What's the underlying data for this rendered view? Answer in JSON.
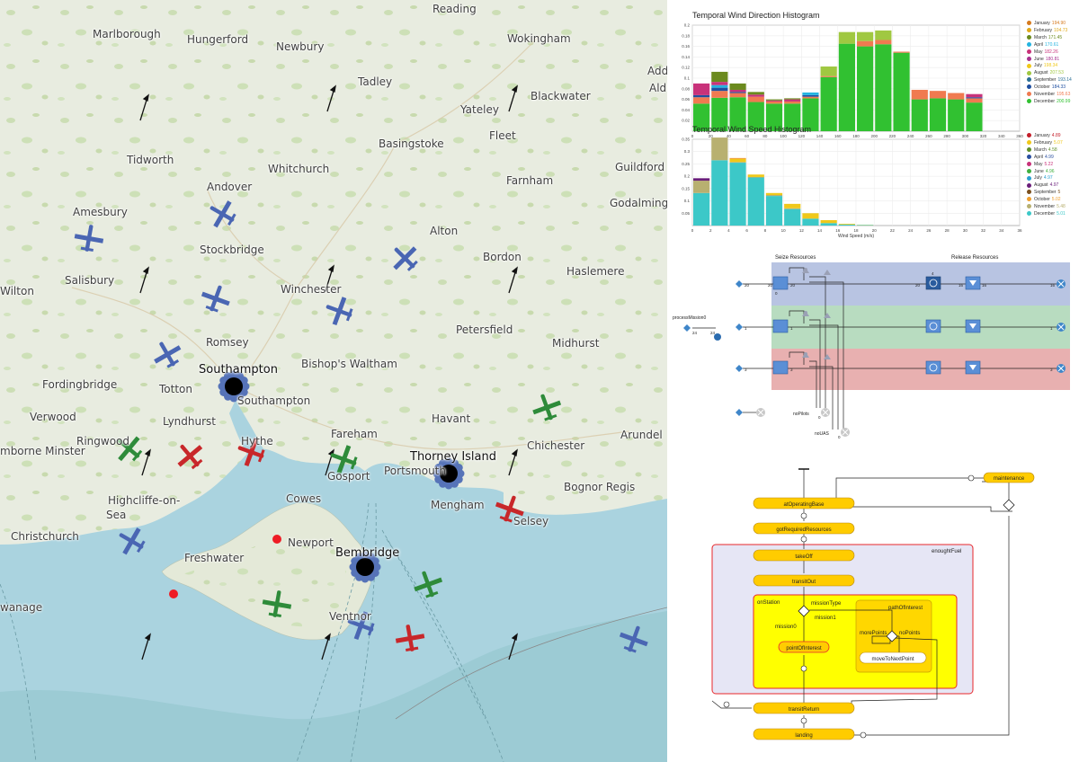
{
  "map": {
    "place_labels": [
      {
        "name": "Reading",
        "x": 481,
        "y": 10
      },
      {
        "name": "Marlborough",
        "x": 103,
        "y": 38
      },
      {
        "name": "Hungerford",
        "x": 208,
        "y": 44
      },
      {
        "name": "Newbury",
        "x": 307,
        "y": 52
      },
      {
        "name": "Wokingham",
        "x": 564,
        "y": 43
      },
      {
        "name": "Add",
        "x": 720,
        "y": 79
      },
      {
        "name": "Tadley",
        "x": 398,
        "y": 91
      },
      {
        "name": "Blackwater",
        "x": 590,
        "y": 107
      },
      {
        "name": "Yateley",
        "x": 512,
        "y": 122
      },
      {
        "name": "Ald",
        "x": 722,
        "y": 98
      },
      {
        "name": "Fleet",
        "x": 544,
        "y": 151
      },
      {
        "name": "Basingstoke",
        "x": 421,
        "y": 160
      },
      {
        "name": "Tidworth",
        "x": 141,
        "y": 178
      },
      {
        "name": "Whitchurch",
        "x": 298,
        "y": 188
      },
      {
        "name": "Farnham",
        "x": 563,
        "y": 201
      },
      {
        "name": "Guildford",
        "x": 684,
        "y": 186
      },
      {
        "name": "Andover",
        "x": 230,
        "y": 208
      },
      {
        "name": "Godalming",
        "x": 678,
        "y": 226
      },
      {
        "name": "Amesbury",
        "x": 81,
        "y": 236
      },
      {
        "name": "Stockbridge",
        "x": 222,
        "y": 278
      },
      {
        "name": "Alton",
        "x": 478,
        "y": 257
      },
      {
        "name": "Bordon",
        "x": 537,
        "y": 286
      },
      {
        "name": "Haslemere",
        "x": 630,
        "y": 302
      },
      {
        "name": "Salisbury",
        "x": 72,
        "y": 312
      },
      {
        "name": "Wilton",
        "x": 0,
        "y": 324
      },
      {
        "name": "Winchester",
        "x": 312,
        "y": 322
      },
      {
        "name": "Romsey",
        "x": 229,
        "y": 381
      },
      {
        "name": "Petersfield",
        "x": 507,
        "y": 367
      },
      {
        "name": "Midhurst",
        "x": 614,
        "y": 382
      },
      {
        "name": "Bishop's Waltham",
        "x": 335,
        "y": 405
      },
      {
        "name": "Fordingbridge",
        "x": 47,
        "y": 428
      },
      {
        "name": "Totton",
        "x": 177,
        "y": 433
      },
      {
        "name": "Southampton",
        "x": 264,
        "y": 446
      },
      {
        "name": "Havant",
        "x": 480,
        "y": 466
      },
      {
        "name": "Verwood",
        "x": 33,
        "y": 464
      },
      {
        "name": "Lyndhurst",
        "x": 181,
        "y": 469
      },
      {
        "name": "Ringwood",
        "x": 85,
        "y": 491
      },
      {
        "name": "Hythe",
        "x": 268,
        "y": 491
      },
      {
        "name": "Fareham",
        "x": 368,
        "y": 483
      },
      {
        "name": "Chichester",
        "x": 586,
        "y": 496
      },
      {
        "name": "Arundel",
        "x": 690,
        "y": 484
      },
      {
        "name": "Portsmouth",
        "x": 427,
        "y": 524
      },
      {
        "name": "Gosport",
        "x": 364,
        "y": 530
      },
      {
        "name": "mborne Minster",
        "x": 0,
        "y": 502
      },
      {
        "name": "Highcliffe-on-",
        "x": 120,
        "y": 557
      },
      {
        "name": "Sea",
        "x": 118,
        "y": 573
      },
      {
        "name": "Cowes",
        "x": 318,
        "y": 555
      },
      {
        "name": "Mengham",
        "x": 479,
        "y": 562
      },
      {
        "name": "Bognor Regis",
        "x": 627,
        "y": 542
      },
      {
        "name": "Selsey",
        "x": 571,
        "y": 580
      },
      {
        "name": "Christchurch",
        "x": 12,
        "y": 597
      },
      {
        "name": "Newport",
        "x": 320,
        "y": 604
      },
      {
        "name": "Freshwater",
        "x": 205,
        "y": 621
      },
      {
        "name": "wanage",
        "x": 0,
        "y": 676
      },
      {
        "name": "Ventnor",
        "x": 366,
        "y": 686
      }
    ],
    "bases": [
      {
        "name": "Southampton",
        "x": 221,
        "y": 412
      },
      {
        "name": "Thorney Island",
        "x": 456,
        "y": 509
      },
      {
        "name": "Bembridge",
        "x": 373,
        "y": 616
      }
    ],
    "colors": {
      "land": "#e8ece0",
      "sea": "#aad3df",
      "sea_deep": "#8fc3c9",
      "plane_blue": "#4a66b3",
      "plane_green": "#2e8b3a",
      "plane_red": "#c8272a",
      "base": "#000000",
      "incident": "#ee1c25"
    }
  },
  "direction_histogram": {
    "title": "Temporal Wind Direction Histogram",
    "xlabel": "Wind Direction (deg)",
    "legend": [
      {
        "month": "January",
        "value": "194.90",
        "color": "#d67a1e"
      },
      {
        "month": "February",
        "value": "104.73",
        "color": "#e0a81a"
      },
      {
        "month": "March",
        "value": "171.45",
        "color": "#6b8a1e"
      },
      {
        "month": "April",
        "value": "170.61",
        "color": "#24b4e0"
      },
      {
        "month": "May",
        "value": "182.26",
        "color": "#c8327a"
      },
      {
        "month": "June",
        "value": "180.81",
        "color": "#a8328f"
      },
      {
        "month": "July",
        "value": "198.34",
        "color": "#f0c81a"
      },
      {
        "month": "August",
        "value": "207.53",
        "color": "#a0c841"
      },
      {
        "month": "September",
        "value": "193.14",
        "color": "#2a6f96"
      },
      {
        "month": "October",
        "value": "184.33",
        "color": "#1f4fa0"
      },
      {
        "month": "November",
        "value": "195.63",
        "color": "#f07a50"
      },
      {
        "month": "December",
        "value": "200.99",
        "color": "#31c131"
      }
    ]
  },
  "speed_histogram": {
    "title": "Temporal Wind Speed Histogram",
    "xlabel": "Wind Speed (m/s)",
    "legend": [
      {
        "month": "January",
        "value": "4.89",
        "color": "#c41e2a"
      },
      {
        "month": "February",
        "value": "5.07",
        "color": "#f0c81a"
      },
      {
        "month": "March",
        "value": "4.58",
        "color": "#5f8f2a"
      },
      {
        "month": "April",
        "value": "4.99",
        "color": "#2a4fa0"
      },
      {
        "month": "May",
        "value": "5.22",
        "color": "#c8327a"
      },
      {
        "month": "June",
        "value": "4.96",
        "color": "#40b040"
      },
      {
        "month": "July",
        "value": "4.97",
        "color": "#2aa0d0"
      },
      {
        "month": "August",
        "value": "4.97",
        "color": "#6a1e7a"
      },
      {
        "month": "September",
        "value": "5",
        "color": "#7a4f1e"
      },
      {
        "month": "October",
        "value": "5.02",
        "color": "#f0a030"
      },
      {
        "month": "November",
        "value": "5.48",
        "color": "#b8b070"
      },
      {
        "month": "December",
        "value": "5.01",
        "color": "#3cc8c8"
      }
    ]
  },
  "chart_data": [
    {
      "type": "bar",
      "title": "Temporal Wind Direction Histogram",
      "xlabel": "Wind Direction (deg)",
      "ylabel": "",
      "xlim": [
        0,
        360
      ],
      "ylim": [
        0,
        0.2
      ],
      "x_ticks": [
        0,
        20,
        40,
        60,
        80,
        100,
        120,
        140,
        160,
        180,
        200,
        220,
        240,
        260,
        280,
        300,
        320,
        340,
        360
      ],
      "y_ticks": [
        0.02,
        0.04,
        0.06,
        0.08,
        0.1,
        0.12,
        0.14,
        0.16,
        0.18,
        0.2
      ],
      "categories": [
        10,
        30,
        50,
        70,
        90,
        110,
        130,
        150,
        170,
        190,
        210,
        230,
        250,
        270,
        290,
        310,
        330,
        350
      ],
      "series": [
        {
          "name": "December",
          "color": "#31c131",
          "values": [
            0.052,
            0.063,
            0.064,
            0.055,
            0.052,
            0.052,
            0.062,
            0.102,
            0.165,
            0.16,
            0.164,
            0.148,
            0.06,
            0.062,
            0.06,
            0.054,
            0,
            0
          ]
        },
        {
          "name": "November",
          "color": "#f07a50",
          "values": [
            0.012,
            0.013,
            0.008,
            0.01,
            0.004,
            0.004,
            0.003,
            0.002,
            0,
            0.01,
            0.008,
            0.002,
            0.018,
            0.014,
            0.012,
            0.008,
            0,
            0
          ]
        },
        {
          "name": "October",
          "color": "#1f4fa0",
          "values": [
            0.004,
            0.006,
            0.002,
            0,
            0,
            0,
            0.003,
            0,
            0,
            0,
            0,
            0,
            0,
            0,
            0,
            0.002,
            0,
            0
          ]
        },
        {
          "name": "April",
          "color": "#24b4e0",
          "values": [
            0,
            0.005,
            0,
            0,
            0,
            0,
            0.005,
            0,
            0,
            0,
            0,
            0,
            0,
            0,
            0,
            0,
            0,
            0
          ]
        },
        {
          "name": "May",
          "color": "#c8327a",
          "values": [
            0.022,
            0.006,
            0.004,
            0.004,
            0.002,
            0.004,
            0,
            0,
            0,
            0,
            0,
            0,
            0,
            0,
            0,
            0.006,
            0,
            0
          ]
        },
        {
          "name": "March",
          "color": "#6b8a1e",
          "values": [
            0,
            0.019,
            0.012,
            0.005,
            0.002,
            0.002,
            0,
            0,
            0,
            0,
            0,
            0,
            0,
            0,
            0,
            0,
            0,
            0
          ]
        },
        {
          "name": "August",
          "color": "#a0c841",
          "values": [
            0,
            0,
            0,
            0,
            0,
            0,
            0,
            0.018,
            0.022,
            0.017,
            0.018,
            0,
            0,
            0,
            0,
            0,
            0,
            0
          ]
        }
      ]
    },
    {
      "type": "bar",
      "title": "Temporal Wind Speed Histogram",
      "xlabel": "Wind Speed (m/s)",
      "ylabel": "",
      "xlim": [
        0,
        36
      ],
      "ylim": [
        0,
        0.35
      ],
      "x_ticks": [
        0,
        2,
        4,
        6,
        8,
        10,
        12,
        14,
        16,
        18,
        20,
        22,
        24,
        26,
        28,
        30,
        32,
        34,
        36
      ],
      "y_ticks": [
        0.05,
        0.1,
        0.15,
        0.2,
        0.25,
        0.3,
        0.35
      ],
      "categories": [
        1,
        3,
        5,
        7,
        9,
        11,
        13,
        15,
        17,
        19,
        21,
        23,
        25,
        27,
        29,
        31,
        33,
        35
      ],
      "series": [
        {
          "name": "December",
          "color": "#3cc8c8",
          "values": [
            0.132,
            0.265,
            0.255,
            0.195,
            0.12,
            0.067,
            0.028,
            0.01,
            0.004,
            0.002,
            0,
            0,
            0,
            0,
            0,
            0,
            0,
            0
          ]
        },
        {
          "name": "November",
          "color": "#b8b070",
          "values": [
            0.05,
            0.092,
            0.003,
            0.002,
            0.004,
            0.003,
            0,
            0,
            0,
            0,
            0,
            0,
            0,
            0,
            0,
            0,
            0,
            0
          ]
        },
        {
          "name": "February",
          "color": "#f0c81a",
          "values": [
            0,
            0,
            0.012,
            0.01,
            0.008,
            0.018,
            0.022,
            0.012,
            0.003,
            0.001,
            0,
            0,
            0,
            0,
            0,
            0,
            0,
            0
          ]
        },
        {
          "name": "August",
          "color": "#6a1e7a",
          "values": [
            0.01,
            0,
            0,
            0,
            0,
            0,
            0,
            0,
            0,
            0,
            0,
            0,
            0,
            0,
            0,
            0,
            0,
            0
          ]
        },
        {
          "name": "October",
          "color": "#f0a030",
          "values": [
            0,
            0,
            0.004,
            0,
            0,
            0,
            0,
            0,
            0,
            0,
            0,
            0,
            0,
            0,
            0,
            0,
            0,
            0
          ]
        }
      ]
    }
  ],
  "resource_diagram": {
    "seize_label": "Seize Resources",
    "release_label": "Release Resources",
    "process_label": "processMission0",
    "nopilots_label": "noPilots",
    "nouas_label": "noUAS",
    "counts": {
      "src0": "20",
      "seize0": "20",
      "seize0_top": "20",
      "delay0": "20",
      "release0": "16",
      "release0_b": "16",
      "sink0": "16",
      "row_small": "0",
      "proc_in": "24",
      "proc_out": "24",
      "seize1_top": "1",
      "seize2_top": "3",
      "small1": "1",
      "small3": "3",
      "nopilots_count": "0",
      "nouas_count": "0",
      "nouas_out": "0",
      "delay0_top": "4",
      "sink1": "1",
      "sink2": "3"
    },
    "band_colors": [
      "#b8c4e2",
      "#b8dcc0",
      "#e8b0b0"
    ]
  },
  "statechart": {
    "states": {
      "maintenance": "maintenance",
      "atOperatingBase": "atOperatingBase",
      "gotRequiredResources": "gotRequiredResources",
      "takeOff": "takeOff",
      "transitOut": "transitOut",
      "pointOfInterest": "pointOfInterest",
      "moveToNextPoint": "moveToNextPoint",
      "transitReturn": "transitReturn",
      "landing": "landing"
    },
    "composites": {
      "enoughtFuel": "enoughtFuel",
      "onStation": "onStation"
    },
    "transitions": {
      "missionType": "missionType",
      "mission0": "mission0",
      "mission1": "mission1",
      "pathOfInterest": "pathOfInterest",
      "morePoints": "morePoints",
      "noPoints": "noPoints"
    }
  }
}
